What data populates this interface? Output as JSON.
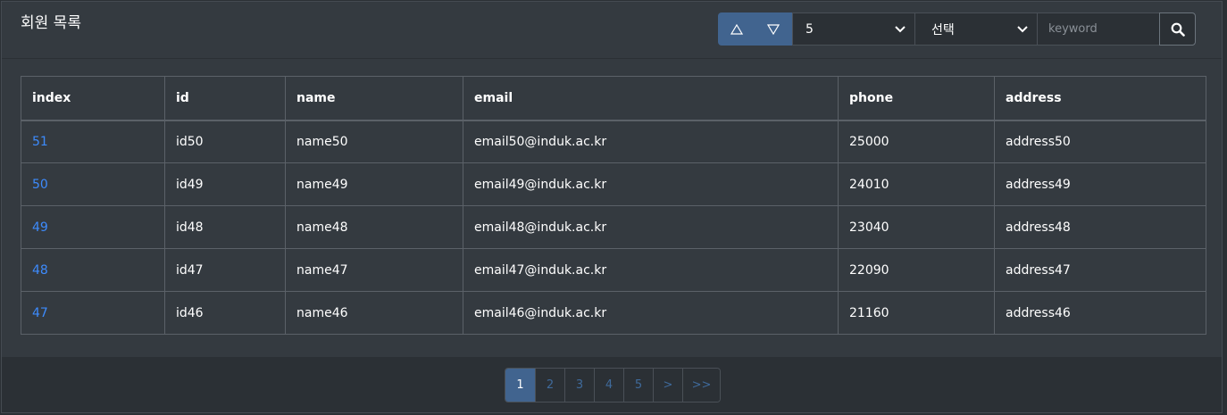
{
  "header": {
    "title": "회원 목록",
    "sort_asc_icon": "triangle-up-icon",
    "sort_desc_icon": "triangle-down-icon",
    "page_size_value": "5",
    "field_select_value": "선택",
    "keyword_placeholder": "keyword",
    "search_icon": "search-icon"
  },
  "table": {
    "columns": [
      "index",
      "id",
      "name",
      "email",
      "phone",
      "address"
    ],
    "rows": [
      {
        "index": "51",
        "id": "id50",
        "name": "name50",
        "email": "email50@induk.ac.kr",
        "phone": "25000",
        "address": "address50"
      },
      {
        "index": "50",
        "id": "id49",
        "name": "name49",
        "email": "email49@induk.ac.kr",
        "phone": "24010",
        "address": "address49"
      },
      {
        "index": "49",
        "id": "id48",
        "name": "name48",
        "email": "email48@induk.ac.kr",
        "phone": "23040",
        "address": "address48"
      },
      {
        "index": "48",
        "id": "id47",
        "name": "name47",
        "email": "email47@induk.ac.kr",
        "phone": "22090",
        "address": "address47"
      },
      {
        "index": "47",
        "id": "id46",
        "name": "name46",
        "email": "email46@induk.ac.kr",
        "phone": "21160",
        "address": "address46"
      }
    ]
  },
  "pagination": {
    "pages": [
      "1",
      "2",
      "3",
      "4",
      "5"
    ],
    "active": "1",
    "next": ">",
    "last": ">>"
  },
  "colors": {
    "background": "#2b3035",
    "card": "#343a40",
    "accent": "#41648f",
    "link": "#3d8bfd"
  }
}
